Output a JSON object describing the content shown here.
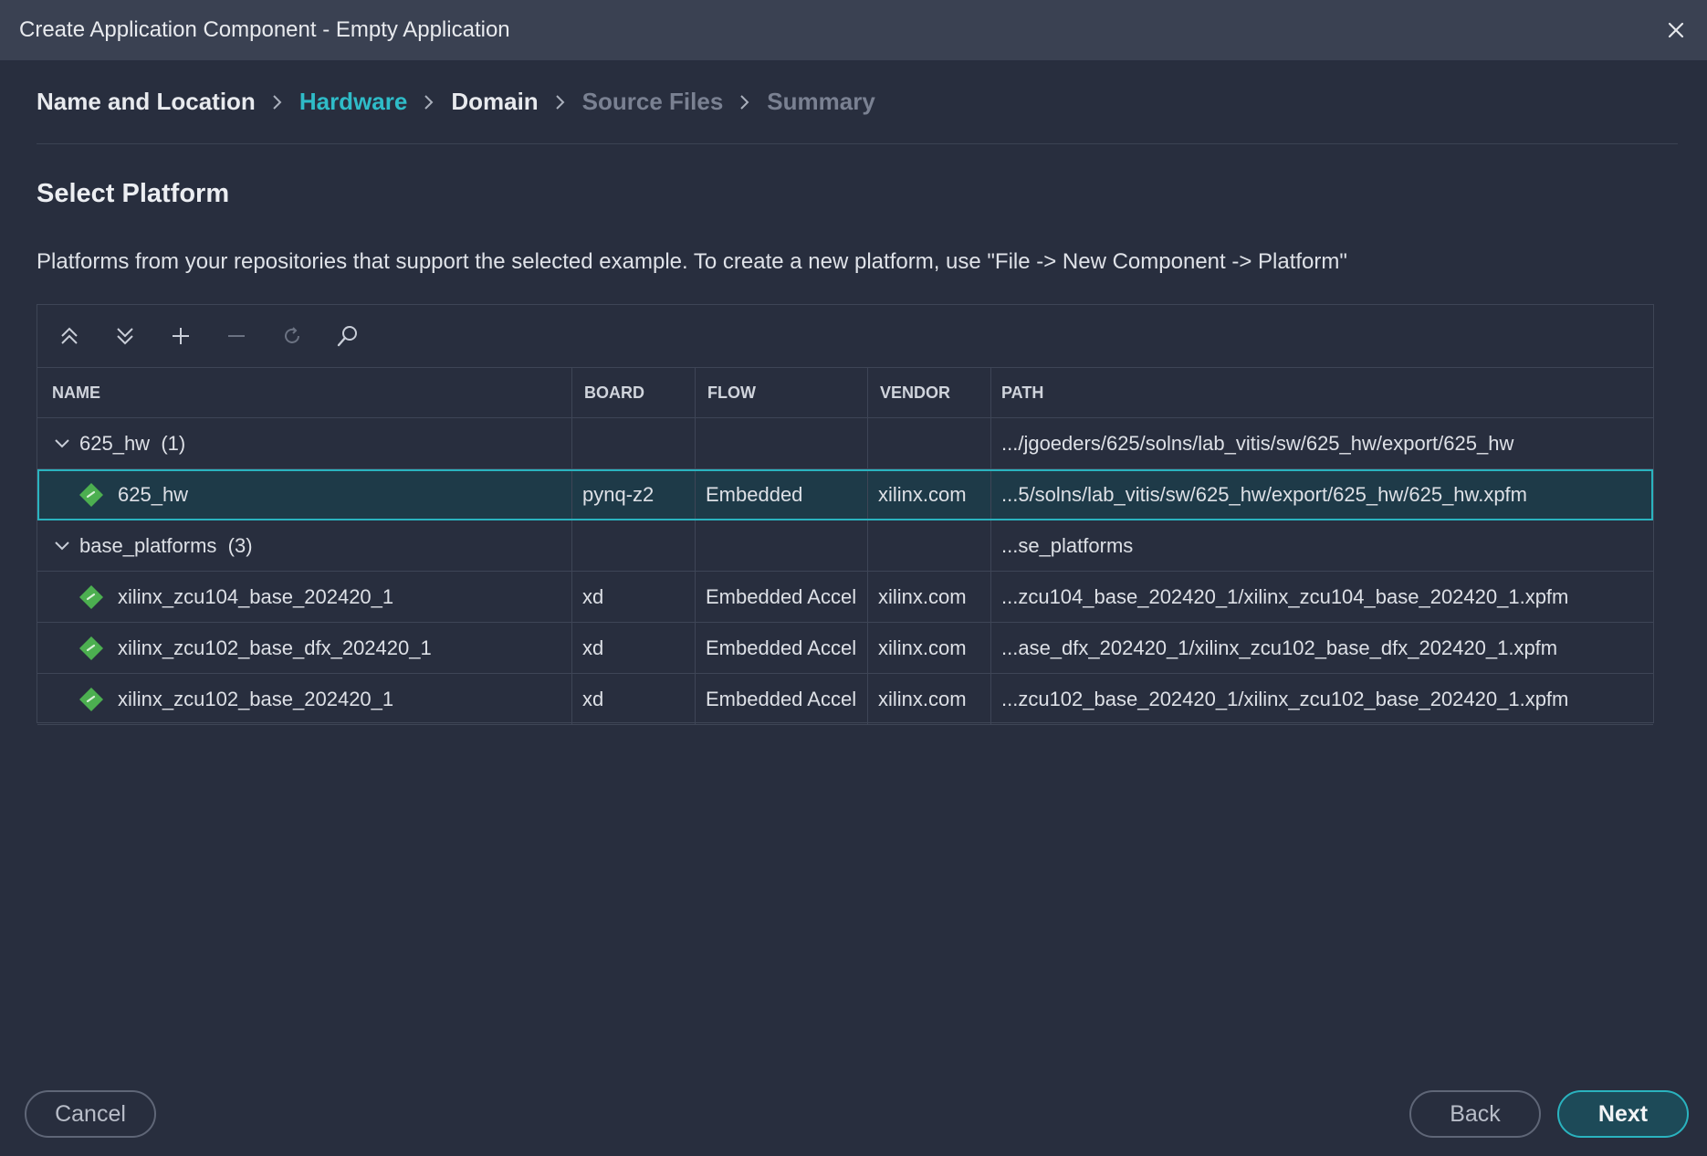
{
  "window": {
    "title": "Create Application Component - Empty Application",
    "close_icon": "close-icon"
  },
  "breadcrumb": {
    "steps": [
      {
        "label": "Name and Location",
        "state": "done"
      },
      {
        "label": "Hardware",
        "state": "active"
      },
      {
        "label": "Domain",
        "state": "done"
      },
      {
        "label": "Source Files",
        "state": "disabled"
      },
      {
        "label": "Summary",
        "state": "disabled"
      }
    ]
  },
  "section": {
    "title": "Select Platform",
    "description": "Platforms from your repositories that support the selected example. To create a new platform, use \"File -> New Component -> Platform\""
  },
  "toolbar": {
    "icons": [
      "collapse-all-icon",
      "expand-all-icon",
      "add-icon",
      "remove-icon",
      "refresh-icon",
      "search-icon"
    ]
  },
  "table": {
    "columns": [
      "NAME",
      "BOARD",
      "FLOW",
      "VENDOR",
      "PATH"
    ],
    "groups": [
      {
        "name": "625_hw",
        "count": "(1)",
        "path": ".../jgoeders/625/solns/lab_vitis/sw/625_hw/export/625_hw",
        "rows": [
          {
            "name": "625_hw",
            "board": "pynq-z2",
            "flow": "Embedded",
            "vendor": "xilinx.com",
            "path": "...5/solns/lab_vitis/sw/625_hw/export/625_hw/625_hw.xpfm",
            "selected": true
          }
        ]
      },
      {
        "name": "base_platforms",
        "count": "(3)",
        "path": "...se_platforms",
        "rows": [
          {
            "name": "xilinx_zcu104_base_202420_1",
            "board": "xd",
            "flow": "Embedded Accel",
            "vendor": "xilinx.com",
            "path": "...zcu104_base_202420_1/xilinx_zcu104_base_202420_1.xpfm",
            "selected": false
          },
          {
            "name": "xilinx_zcu102_base_dfx_202420_1",
            "board": "xd",
            "flow": "Embedded Accel",
            "vendor": "xilinx.com",
            "path": "...ase_dfx_202420_1/xilinx_zcu102_base_dfx_202420_1.xpfm",
            "selected": false
          },
          {
            "name": "xilinx_zcu102_base_202420_1",
            "board": "xd",
            "flow": "Embedded Accel",
            "vendor": "xilinx.com",
            "path": "...zcu102_base_202420_1/xilinx_zcu102_base_202420_1.xpfm",
            "selected": false
          }
        ]
      }
    ]
  },
  "buttons": {
    "cancel": "Cancel",
    "back": "Back",
    "next": "Next"
  },
  "colors": {
    "accent": "#2fbcc8",
    "background": "#282e3e",
    "titlebar": "#3a4152",
    "platform_icon": "#4caf50"
  }
}
